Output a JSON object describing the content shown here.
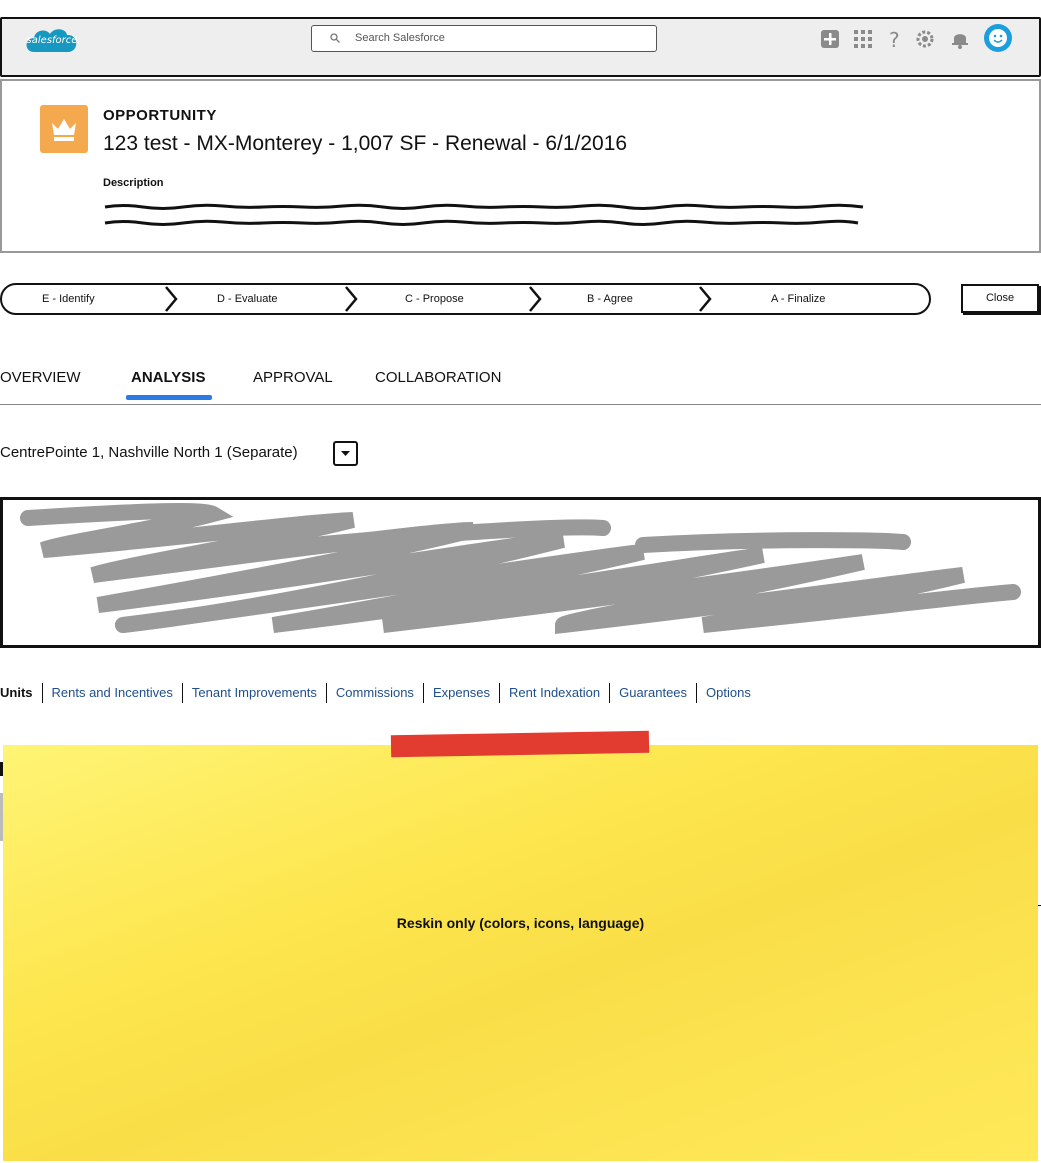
{
  "header": {
    "logo_text": "salesforce",
    "search_placeholder": "Search Salesforce",
    "icons": [
      "plus-icon",
      "app-launcher-icon",
      "help-icon",
      "settings-icon",
      "notification-icon",
      "avatar-icon"
    ]
  },
  "record": {
    "type": "OPPORTUNITY",
    "title": "123 test - MX-Monterey - 1,007 SF - Renewal - 6/1/2016",
    "description_label": "Description",
    "icon": "crown-icon",
    "icon_color": "#f5a94e"
  },
  "path": {
    "stages": [
      "E - Identify",
      "D - Evaluate",
      "C - Propose",
      "B - Agree",
      "A - Finalize"
    ],
    "close_label": "Close"
  },
  "tabs": {
    "items": [
      "OVERVIEW",
      "ANALYSIS",
      "APPROVAL",
      "COLLABORATION"
    ],
    "active": "ANALYSIS",
    "accent": "#2c7be5"
  },
  "property": {
    "label": "CentrePointe 1, Nashville North 1 (Separate)"
  },
  "subtabs": {
    "items": [
      "Units",
      "Rents and Incentives",
      "Tenant Improvements",
      "Commissions",
      "Expenses",
      "Rent Indexation",
      "Guarantees",
      "Options"
    ],
    "active": "Units",
    "link_color": "#1f4e8c"
  },
  "sticky": {
    "text": "Reskin only (colors, icons, language)",
    "tape_color": "#e23b30"
  }
}
